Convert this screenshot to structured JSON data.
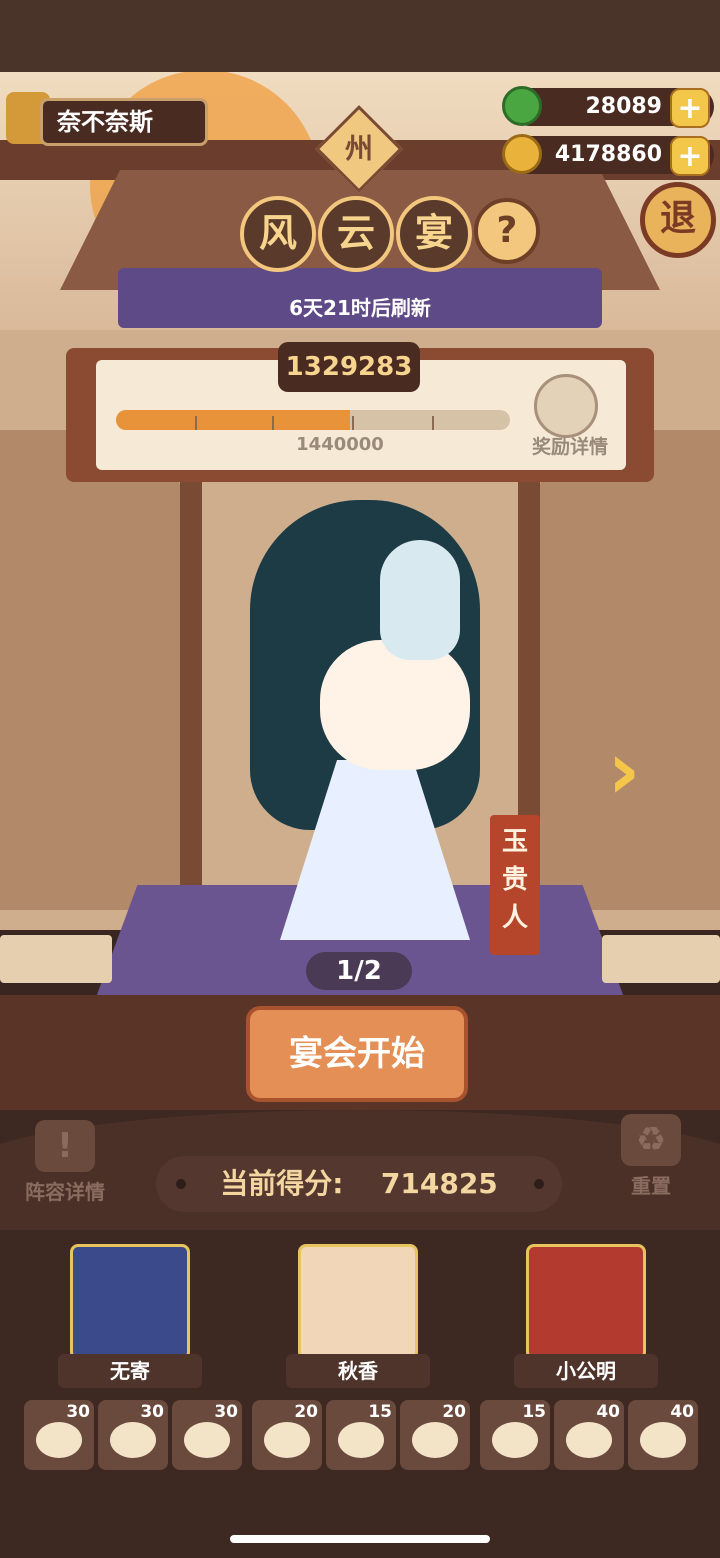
{
  "player": {
    "name": "奈不奈斯"
  },
  "currencies": [
    {
      "name": "green-apple",
      "value": "28089",
      "color": "#4aa640"
    },
    {
      "name": "gold-coin",
      "value": "4178860",
      "color": "#e9b23b"
    }
  ],
  "exit_label": "退",
  "region_label": "州",
  "title_chars": [
    "风",
    "云",
    "宴"
  ],
  "help_label": "?",
  "refresh_text": "6天21时后刷新",
  "score_panel": {
    "current": "1329283",
    "target": "1440000",
    "progress": 0.595,
    "reward_label": "奖励详情"
  },
  "character": {
    "name": "玉贵人",
    "page": "1/2",
    "next_arrow": "›"
  },
  "start_button": "宴会开始",
  "lineup_button": "阵容详情",
  "reset_button": "重置",
  "current_score": {
    "label": "当前得分:",
    "value": "714825"
  },
  "guests": [
    {
      "name": "无寄",
      "color": "#3b4a8a"
    },
    {
      "name": "秋香",
      "color": "#f2d6b8"
    },
    {
      "name": "小公明",
      "color": "#b33a2e"
    }
  ],
  "dishes": [
    {
      "count": "30"
    },
    {
      "count": "30"
    },
    {
      "count": "30"
    },
    {
      "count": "20"
    },
    {
      "count": "15"
    },
    {
      "count": "20"
    },
    {
      "count": "15"
    },
    {
      "count": "40"
    },
    {
      "count": "40"
    }
  ]
}
